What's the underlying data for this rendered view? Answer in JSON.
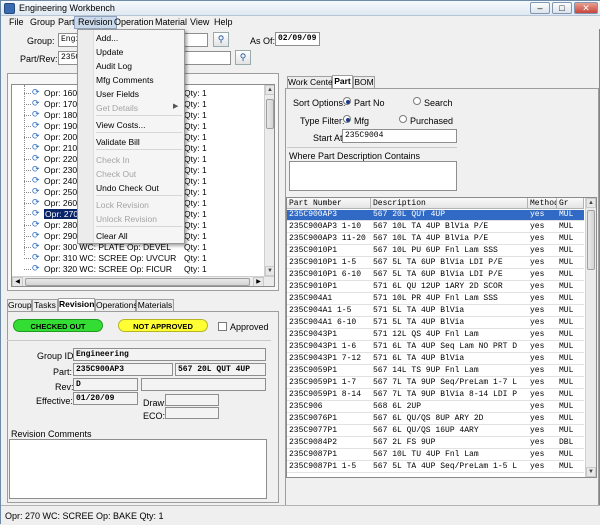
{
  "window": {
    "title": "Engineering Workbench",
    "min_glyph": "–",
    "max_glyph": "□",
    "close_glyph": "✕"
  },
  "menu": {
    "items": [
      "File",
      "Group",
      "Part",
      "Revision",
      "Operation",
      "Material",
      "View",
      "Help"
    ],
    "open": "Revision"
  },
  "header": {
    "group_label": "Group:",
    "group_value": "Engi",
    "part_label": "Part/Rev:",
    "part_value": "235C",
    "asof_label": "As Of:",
    "asof_value": "02/09/09"
  },
  "revision_menu": [
    {
      "label": "Add...",
      "enabled": true
    },
    {
      "label": "Update",
      "enabled": true
    },
    {
      "label": "Audit Log",
      "enabled": true
    },
    {
      "label": "Mfg Comments",
      "enabled": true
    },
    {
      "label": "User Fields",
      "enabled": true
    },
    {
      "label": "Get Details",
      "enabled": false,
      "submenu": true
    },
    {
      "label": "View Costs...",
      "enabled": true
    },
    {
      "label": "Validate Bill",
      "enabled": true
    },
    {
      "label": "Check In",
      "enabled": false
    },
    {
      "label": "Check Out",
      "enabled": false
    },
    {
      "label": "Undo Check Out",
      "enabled": true
    },
    {
      "label": "Lock Revision",
      "enabled": false
    },
    {
      "label": "Unlock Revision",
      "enabled": false
    },
    {
      "label": "Clear All",
      "enabled": true
    }
  ],
  "tree": {
    "rows": [
      {
        "op": "Opr: 160",
        "qty": "Qty: 1"
      },
      {
        "op": "Opr: 170",
        "qty": "Qty: 1"
      },
      {
        "op": "Opr: 180",
        "qty": "Qty: 1"
      },
      {
        "op": "Opr: 190",
        "qty": "Qty: 1"
      },
      {
        "op": "Opr: 200",
        "qty": "Qty: 1"
      },
      {
        "op": "Opr: 210",
        "qty": "Qty: 1"
      },
      {
        "op": "Opr: 220",
        "qty": "Qty: 1"
      },
      {
        "op": "Opr: 230",
        "qty": "Qty: 1"
      },
      {
        "op": "Opr: 240",
        "qty": "Qty: 1"
      },
      {
        "op": "Opr: 250",
        "qty": "Qty: 1"
      },
      {
        "op": "Opr: 260",
        "qty": "Qty: 1"
      },
      {
        "op": "Opr: 270",
        "qty": "Qty: 1",
        "selected": true
      },
      {
        "op": "Opr: 280",
        "qty": "Qty: 1"
      },
      {
        "op": "Opr: 290",
        "qty": "Qty: 1"
      },
      {
        "op": "Opr: 300 WC: PLATE Op: DEVEL",
        "qty": "Qty: 1"
      },
      {
        "op": "Opr: 310 WC: SCREE Op: UVCUR",
        "qty": "Qty: 1"
      },
      {
        "op": "Opr: 320 WC: SCREE Op: FICUR",
        "qty": "Qty: 1"
      }
    ]
  },
  "left_tabs": [
    "Group",
    "Tasks",
    "Revision",
    "Operations",
    "Materials"
  ],
  "revision_panel": {
    "checked_out": "CHECKED OUT",
    "approval": "NOT APPROVED",
    "approved_label": "Approved",
    "group_id_label": "Group ID:",
    "group_id": "Engineering",
    "part_label": "Part:",
    "part": "235C900AP3",
    "part_desc": "567 20L QUT 4UP",
    "rev_label": "Rev:",
    "rev": "D",
    "effective_label": "Effective:",
    "effective": "01/20/09",
    "draw_label": "Draw:",
    "eco_label": "ECO:",
    "comments_label": "Revision Comments"
  },
  "right_tabs": [
    "Work Center",
    "Part",
    "BOM"
  ],
  "sort": {
    "sort_label": "Sort Options:",
    "opt1": "Part No",
    "opt2": "Search",
    "type_label": "Type Filter:",
    "type1": "Mfg",
    "type2": "Purchased",
    "start_label": "Start At:",
    "start_value": "235C9004",
    "desc_label": "Where Part Description Contains"
  },
  "grid": {
    "columns": [
      "Part Number",
      "Description",
      "Method",
      "Gr"
    ],
    "rows": [
      [
        "235C900AP3",
        "567 20L QUT 4UP",
        "yes",
        "MUL",
        true
      ],
      [
        "235C900AP3 1-10",
        "567 10L TA 4UP BlVia P/E",
        "yes",
        "MUL",
        false
      ],
      [
        "235C900AP3 11-20",
        "567 10L TA 4UP BlVia P/E",
        "yes",
        "MUL",
        false
      ],
      [
        "235C9010P1",
        "567 10L PU 6UP Fnl Lam SSS",
        "yes",
        "MUL",
        false
      ],
      [
        "235C9010P1 1-5",
        "567 5L TA 6UP BlVia LDI P/E",
        "yes",
        "MUL",
        false
      ],
      [
        "235C9010P1 6-10",
        "567 5L TA 6UP BlVia LDI P/E",
        "yes",
        "MUL",
        false
      ],
      [
        "235C9010P1",
        "571 6L QU 12UP 1ARY 2D SCOR",
        "yes",
        "MUL",
        false
      ],
      [
        "235C904A1",
        "571 10L PR 4UP Fnl Lam SSS",
        "yes",
        "MUL",
        false
      ],
      [
        "235C904A1 1-5",
        "571 5L TA 4UP BlVia",
        "yes",
        "MUL",
        false
      ],
      [
        "235C904A1 6-10",
        "571 5L TA 4UP BlVia",
        "yes",
        "MUL",
        false
      ],
      [
        "235C9043P1",
        "571 12L QS 4UP Fnl Lam",
        "yes",
        "MUL",
        false
      ],
      [
        "235C9043P1 1-6",
        "571 6L TA 4UP Seq Lam NO PRT D",
        "yes",
        "MUL",
        false
      ],
      [
        "235C9043P1 7-12",
        "571 6L TA 4UP BlVia",
        "yes",
        "MUL",
        false
      ],
      [
        "235C9059P1",
        "567 14L TS 9UP Fnl Lam",
        "yes",
        "MUL",
        false
      ],
      [
        "235C9059P1 1-7",
        "567 7L TA 9UP Seq/PreLam 1-7 L",
        "yes",
        "MUL",
        false
      ],
      [
        "235C9059P1 8-14",
        "567 7L TA 9UP BlVia 8-14 LDI P",
        "yes",
        "MUL",
        false
      ],
      [
        "235C906",
        "568 6L 2UP",
        "yes",
        "MUL",
        false
      ],
      [
        "235C9076P1",
        "567 6L QU/QS 8UP ARY 2D",
        "yes",
        "MUL",
        false
      ],
      [
        "235C9077P1",
        "567 6L QU/QS 16UP 4ARY",
        "yes",
        "MUL",
        false
      ],
      [
        "235C9084P2",
        "567 2L FS 9UP",
        "yes",
        "DBL",
        false
      ],
      [
        "235C9087P1",
        "567 10L TU 4UP Fnl Lam",
        "yes",
        "MUL",
        false
      ],
      [
        "235C9087P1 1-5",
        "567 5L TA 4UP Seq/PreLam 1-5 L",
        "yes",
        "MUL",
        false
      ]
    ]
  },
  "status": {
    "text": "Opr: 270 WC: SCREE Op: BAKE Qty: 1"
  },
  "icons": {
    "search": "magnifier-icon",
    "op": "operation-icon"
  },
  "colors": {
    "checked_out": "#33dd33",
    "not_approved": "#ffff33",
    "selection": "#316ac5"
  }
}
